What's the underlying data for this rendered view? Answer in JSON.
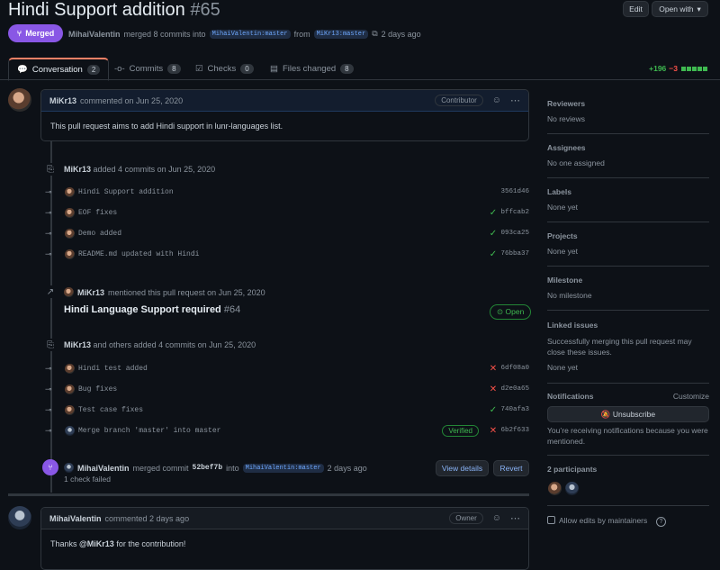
{
  "header": {
    "title": "Hindi Support addition",
    "number": "#65",
    "edit_label": "Edit",
    "open_with_label": "Open with"
  },
  "status": {
    "badge": "Merged",
    "author": "MihaiValentin",
    "merged_text": "merged 8 commits into",
    "base_branch": "MihaiValentin:master",
    "from_text": "from",
    "head_branch": "MiKr13:master",
    "time": "2 days ago"
  },
  "tabs": [
    {
      "label": "Conversation",
      "count": "2"
    },
    {
      "label": "Commits",
      "count": "8"
    },
    {
      "label": "Checks",
      "count": "0"
    },
    {
      "label": "Files changed",
      "count": "8"
    }
  ],
  "diffstat": {
    "additions": "+196",
    "deletions": "−3"
  },
  "first_comment": {
    "author": "MiKr13",
    "time": "commented on Jun 25, 2020",
    "role": "Contributor",
    "body": "This pull request aims to add Hindi support in lunr-languages list."
  },
  "event1": {
    "author": "MiKr13",
    "text": "added 4 commits on Jun 25, 2020"
  },
  "commits1": [
    {
      "msg": "Hindi Support addition",
      "sha": "3561d46",
      "status": "none"
    },
    {
      "msg": "EOF fixes",
      "sha": "bffcab2",
      "status": "ok"
    },
    {
      "msg": "Demo added",
      "sha": "093ca25",
      "status": "ok"
    },
    {
      "msg": "README.md updated with Hindi",
      "sha": "76bba37",
      "status": "ok"
    }
  ],
  "mention": {
    "author": "MiKr13",
    "text": "mentioned this pull request on Jun 25, 2020",
    "issue_title": "Hindi Language Support required",
    "issue_number": "#64",
    "state": "Open"
  },
  "event2": {
    "author": "MiKr13",
    "text": "and others added 4 commits on Jun 25, 2020"
  },
  "commits2": [
    {
      "msg": "Hindi test added",
      "sha": "6df08a0",
      "status": "bad"
    },
    {
      "msg": "Bug fixes",
      "sha": "d2e0a65",
      "status": "bad"
    },
    {
      "msg": "Test case fixes",
      "sha": "740afa3",
      "status": "ok"
    },
    {
      "msg": "Merge branch 'master' into master",
      "sha": "6b2f633",
      "status": "bad",
      "verified": "Verified"
    }
  ],
  "merge_event": {
    "author": "MihaiValentin",
    "text": "merged commit",
    "sha": "52bef7b",
    "into": "into",
    "branch": "MihaiValentin:master",
    "time": "2 days ago",
    "checks": "1 check failed",
    "view_details": "View details",
    "revert": "Revert"
  },
  "second_comment": {
    "author": "MihaiValentin",
    "time": "commented 2 days ago",
    "role": "Owner",
    "body_prefix": "Thanks",
    "mention": "@MiKr13",
    "body_suffix": "for the contribution!"
  },
  "sidebar": {
    "reviewers": {
      "title": "Reviewers",
      "value": "No reviews"
    },
    "assignees": {
      "title": "Assignees",
      "value": "No one assigned"
    },
    "labels": {
      "title": "Labels",
      "value": "None yet"
    },
    "projects": {
      "title": "Projects",
      "value": "None yet"
    },
    "milestone": {
      "title": "Milestone",
      "value": "No milestone"
    },
    "linked": {
      "title": "Linked issues",
      "desc": "Successfully merging this pull request may close these issues.",
      "value": "None yet"
    },
    "notifications": {
      "title": "Notifications",
      "customize": "Customize",
      "button": "Unsubscribe",
      "desc": "You’re receiving notifications because you were mentioned."
    },
    "participants": {
      "title": "2 participants"
    },
    "allow_edits": "Allow edits by maintainers"
  },
  "colors": {
    "merged": "#8957e5",
    "accent": "#f78166",
    "success": "#3fb950",
    "danger": "#f85149"
  }
}
